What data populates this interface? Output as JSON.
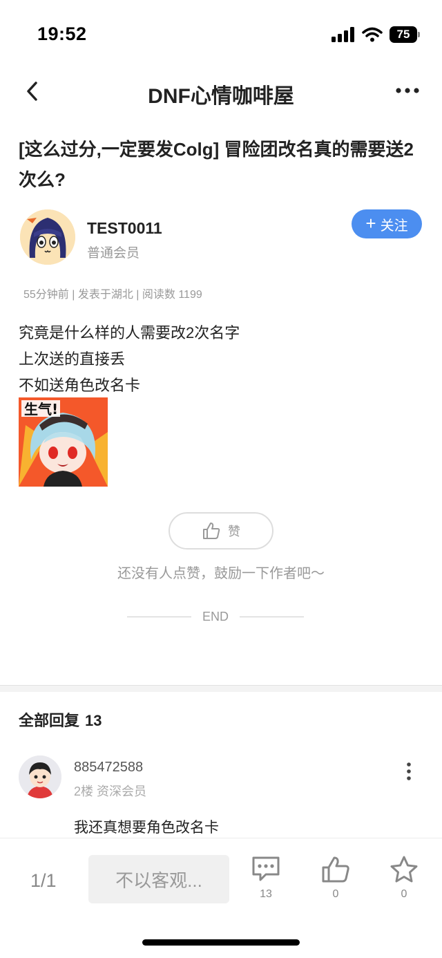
{
  "status_bar": {
    "time": "19:52",
    "battery": "75"
  },
  "nav": {
    "title": "DNF心情咖啡屋"
  },
  "post": {
    "title": "[这么过分,一定要发Colg] 冒险团改名真的需要送2次么?",
    "author": {
      "name": "TEST0011",
      "role": "普通会员"
    },
    "follow_label": "关注",
    "meta": "55分钟前 | 发表于湖北 | 阅读数 1199",
    "body_lines": [
      "究竟是什么样的人需要改2次名字",
      "上次送的直接丢",
      "不如送角色改名卡"
    ],
    "sticker_text": "生气!",
    "like_label": "赞",
    "like_hint": "还没有人点赞，鼓励一下作者吧～",
    "end_label": "END"
  },
  "replies": {
    "header": "全部回复",
    "count": "13",
    "items": [
      {
        "user": "885472588",
        "floor": "2楼 资深会员",
        "text": "我还真想要角色改名卡"
      }
    ]
  },
  "bottom_bar": {
    "page": "1/1",
    "input_placeholder": "不以客观...",
    "comment_count": "13",
    "like_count": "0",
    "favorite_count": "0"
  },
  "colors": {
    "accent": "#4c8ef0",
    "muted": "#999999",
    "text": "#222222"
  }
}
